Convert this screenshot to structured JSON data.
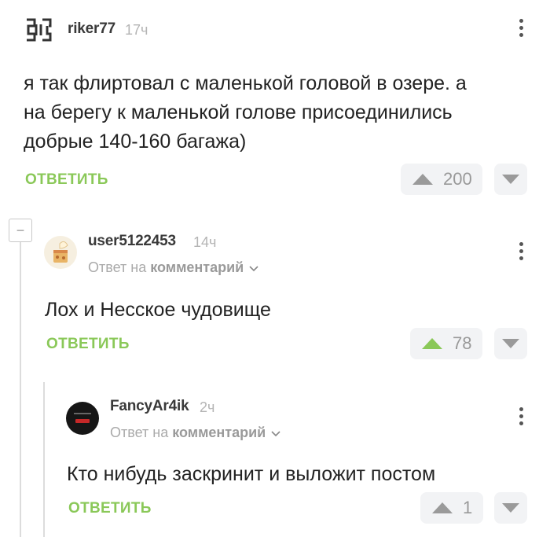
{
  "comments": [
    {
      "username": "riker77",
      "time": "17ч",
      "text_lines": [
        "я так флиртовал с маленькой головой в озере. а",
        "на берегу к маленькой голове присоединились",
        "добрые 140-160 багажа)"
      ],
      "reply_label": "ОТВЕТИТЬ",
      "votes": "200",
      "avatar_icon": "rammstein-logo-icon"
    },
    {
      "username": "user5122453",
      "time": "14ч",
      "reply_to_prefix": "Ответ на",
      "reply_to_link": "комментарий",
      "text": "Лох и Несское чудовище",
      "reply_label": "ОТВЕТИТЬ",
      "votes": "78",
      "avatar_icon": "cake-avatar-icon"
    },
    {
      "username": "FancyAr4ik",
      "time": "2ч",
      "reply_to_prefix": "Ответ на",
      "reply_to_link": "комментарий",
      "text": "Кто нибудь заскринит и выложит постом",
      "reply_label": "ОТВЕТИТЬ",
      "votes": "1",
      "avatar_icon": "dark-avatar-icon"
    }
  ],
  "colors": {
    "accent_green": "#8ac858",
    "vote_bg": "#f2f3f5",
    "upvote_active": "#8ac858",
    "upvote_inactive": "#9a9a9a"
  },
  "collapse_symbol": "−"
}
